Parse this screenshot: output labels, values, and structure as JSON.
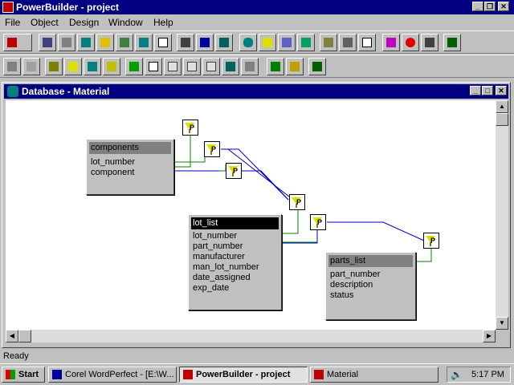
{
  "app": {
    "title": "PowerBuilder - project"
  },
  "menu": {
    "items": [
      "File",
      "Object",
      "Design",
      "Window",
      "Help"
    ]
  },
  "child": {
    "title": "Database - Material"
  },
  "tables": {
    "components": {
      "name": "components",
      "columns": [
        "lot_number",
        "component"
      ]
    },
    "lot_list": {
      "name": "lot_list",
      "columns": [
        "lot_number",
        "part_number",
        "manufacturer",
        "man_lot_number",
        "date_assigned",
        "exp_date"
      ]
    },
    "parts_list": {
      "name": "parts_list",
      "columns": [
        "part_number",
        "description",
        "status"
      ]
    }
  },
  "status": {
    "text": "Ready"
  },
  "taskbar": {
    "start": "Start",
    "items": [
      "Corel WordPerfect - [E:\\W...",
      "PowerBuilder - project",
      "Material"
    ],
    "clock": "5:17 PM"
  },
  "colors": {
    "titlebar": "#000080",
    "face": "#c0c0c0",
    "join_line_blue": "#0000c0",
    "join_line_green": "#008000"
  }
}
